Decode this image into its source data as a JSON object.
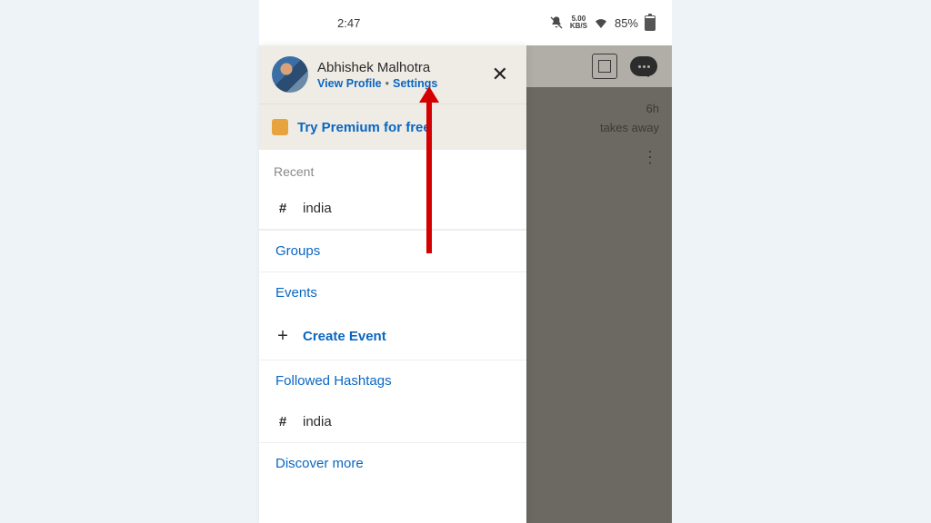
{
  "statusbar": {
    "time": "2:47",
    "net_rate": "5.00",
    "net_unit": "KB/S",
    "battery_pct": "85%"
  },
  "background": {
    "feed_snippet": "takes away",
    "feed_age": "6h"
  },
  "drawer": {
    "user_name": "Abhishek Malhotra",
    "view_profile": "View Profile",
    "settings": "Settings",
    "premium": "Try Premium for free",
    "recent_label": "Recent",
    "recent_items": [
      {
        "text": "india"
      }
    ],
    "groups": "Groups",
    "events": "Events",
    "create_event": "Create Event",
    "followed_hashtags": "Followed Hashtags",
    "hashtag_items": [
      {
        "text": "india"
      }
    ],
    "discover_more": "Discover more"
  }
}
